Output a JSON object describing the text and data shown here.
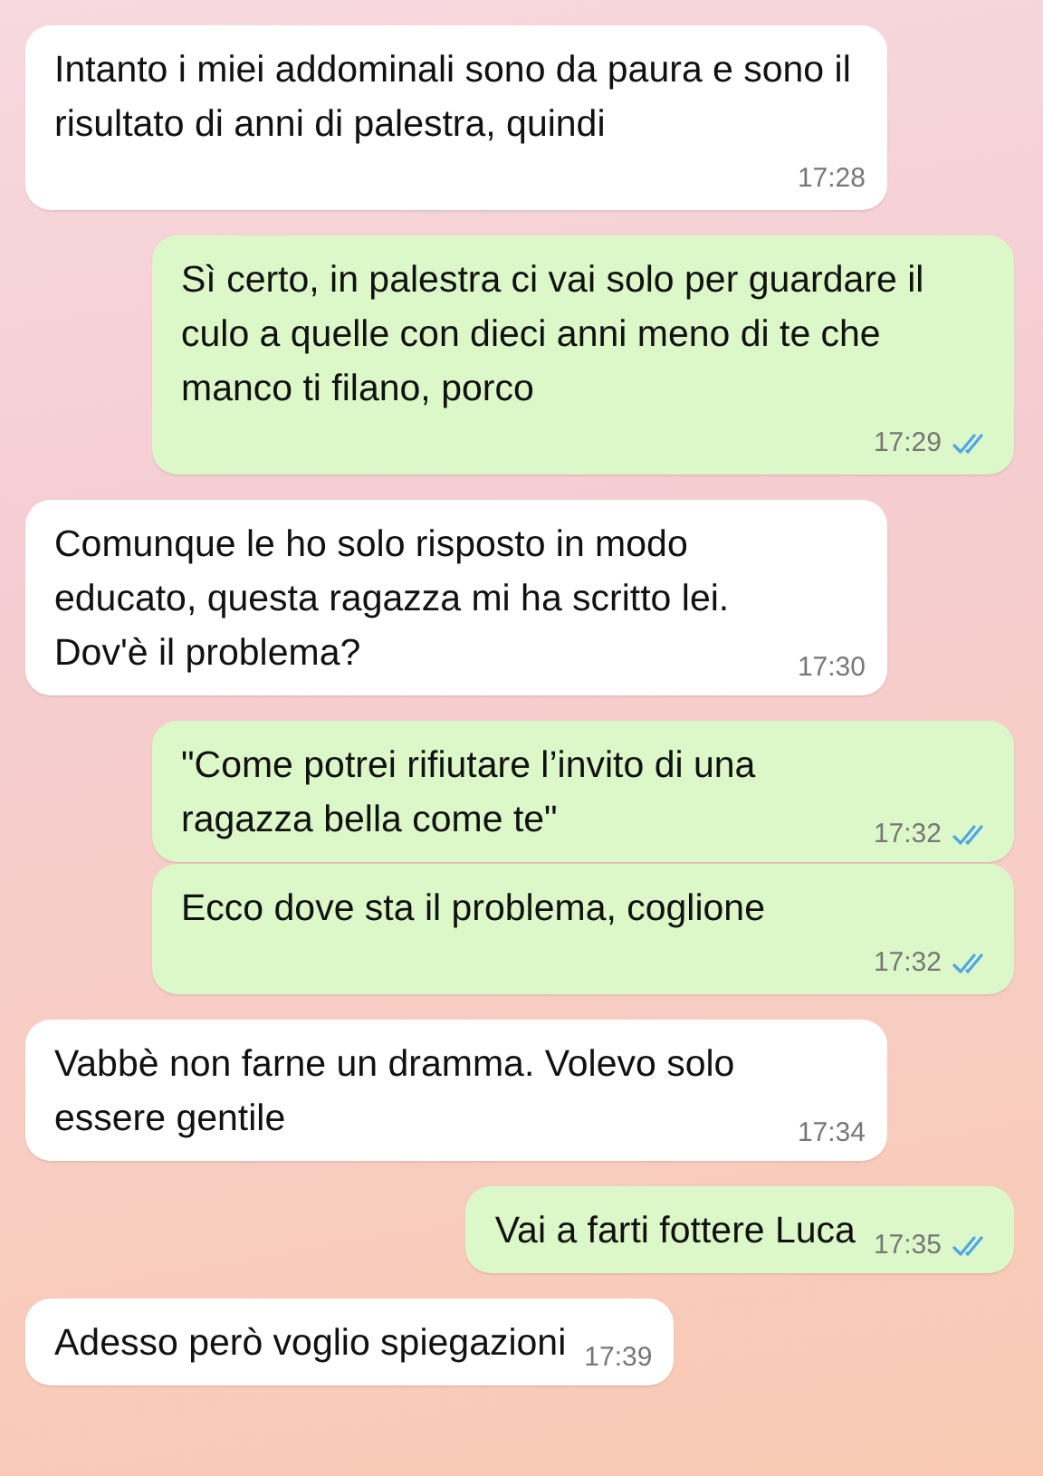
{
  "messages": [
    {
      "outgoing": false,
      "text": "Intanto i miei addominali sono da paura e sono il risultato di anni di palestra, quindi",
      "time": "17:28",
      "time_below": true
    },
    {
      "outgoing": true,
      "text": "Sì certo, in palestra ci vai solo per guardare il culo a quelle con dieci anni meno di te che manco ti filano, porco",
      "time": "17:29",
      "time_below": true,
      "read": true
    },
    {
      "outgoing": false,
      "text": "Comunque le ho solo risposto in modo educato, questa ragazza mi ha scritto lei. Dov'è il problema?",
      "time": "17:30",
      "time_below": false
    },
    {
      "outgoing": true,
      "text": "\"Come potrei rifiutare l’invito di una ragazza bella come te\"",
      "time": "17:32",
      "time_below": false,
      "read": true
    },
    {
      "outgoing": true,
      "text": "Ecco dove sta il problema, coglione",
      "time": "17:32",
      "time_below": true,
      "read": true
    },
    {
      "outgoing": false,
      "text": "Vabbè non farne un dramma. Volevo solo essere gentile",
      "time": "17:34",
      "time_below": false
    },
    {
      "outgoing": true,
      "text": "Vai a farti fottere Luca",
      "time": "17:35",
      "time_below": false,
      "read": true
    },
    {
      "outgoing": false,
      "text": "Adesso però voglio spiegazioni",
      "time": "17:39",
      "time_below": false
    }
  ]
}
